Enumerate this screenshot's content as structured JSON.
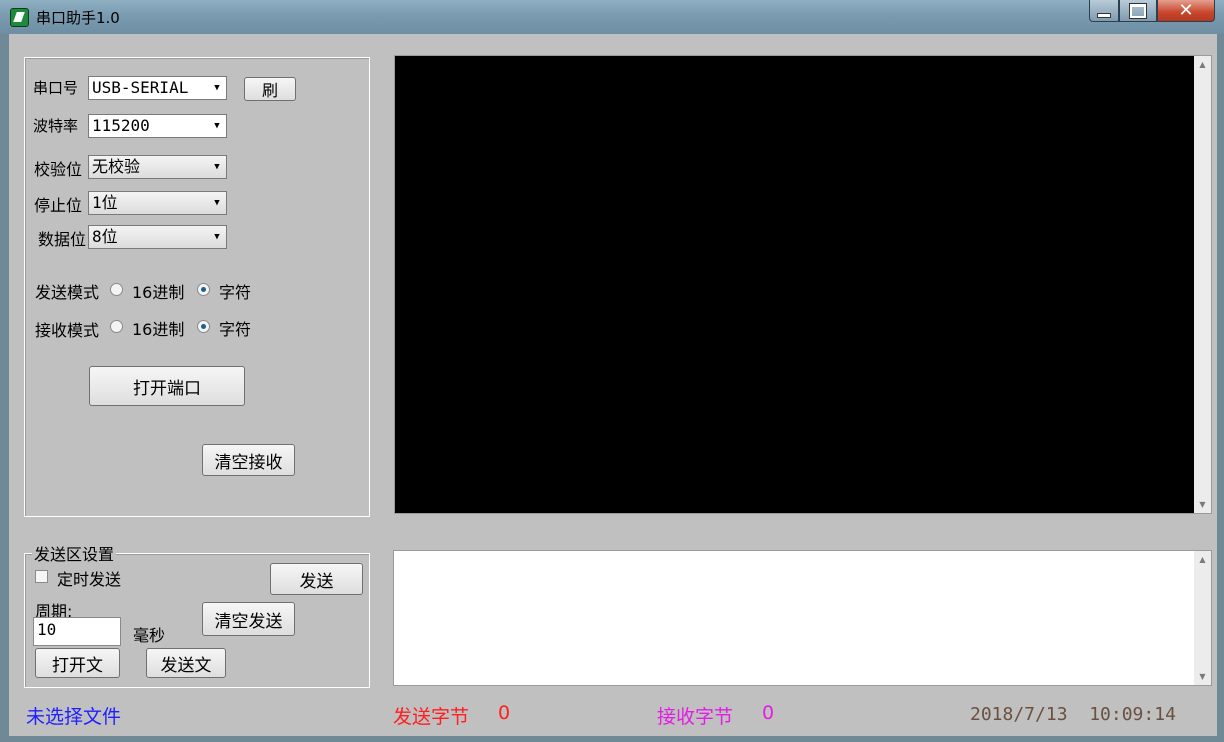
{
  "window": {
    "title": "串口助手1.0"
  },
  "serial_settings": {
    "port_label": "串口号",
    "port_value": "USB-SERIAL",
    "refresh_label": "刷",
    "baud_label": "波特率",
    "baud_value": "115200",
    "parity_label": "校验位",
    "parity_value": "无校验",
    "stopbits_label": "停止位",
    "stopbits_value": "1位",
    "databits_label": "数据位",
    "databits_value": "8位",
    "send_mode_label": "发送模式",
    "receive_mode_label": "接收模式",
    "mode_hex": "16进制",
    "mode_char": "字符",
    "send_mode_selected": "字符",
    "receive_mode_selected": "字符",
    "open_port_label": "打开端口",
    "clear_receive_label": "清空接收"
  },
  "send_settings": {
    "group_title": "发送区设置",
    "timed_send_label": "定时发送",
    "timed_send_checked": false,
    "send_label": "发送",
    "period_label": "周期:",
    "period_value": "10",
    "period_unit": "毫秒",
    "clear_send_label": "清空发送",
    "open_file_label": "打开文",
    "send_file_label": "发送文"
  },
  "status_bar": {
    "file_status": "未选择文件",
    "sent_bytes_label": "发送字节",
    "sent_bytes_value": "0",
    "received_bytes_label": "接收字节",
    "received_bytes_value": "0",
    "datetime": "2018/7/13  10:09:14"
  },
  "colors": {
    "file_status": "#1f1fff",
    "sent_bytes": "#ff1f1f",
    "received_bytes": "#e31ee3",
    "datetime": "#6a5040",
    "receive_background": "#000000"
  }
}
